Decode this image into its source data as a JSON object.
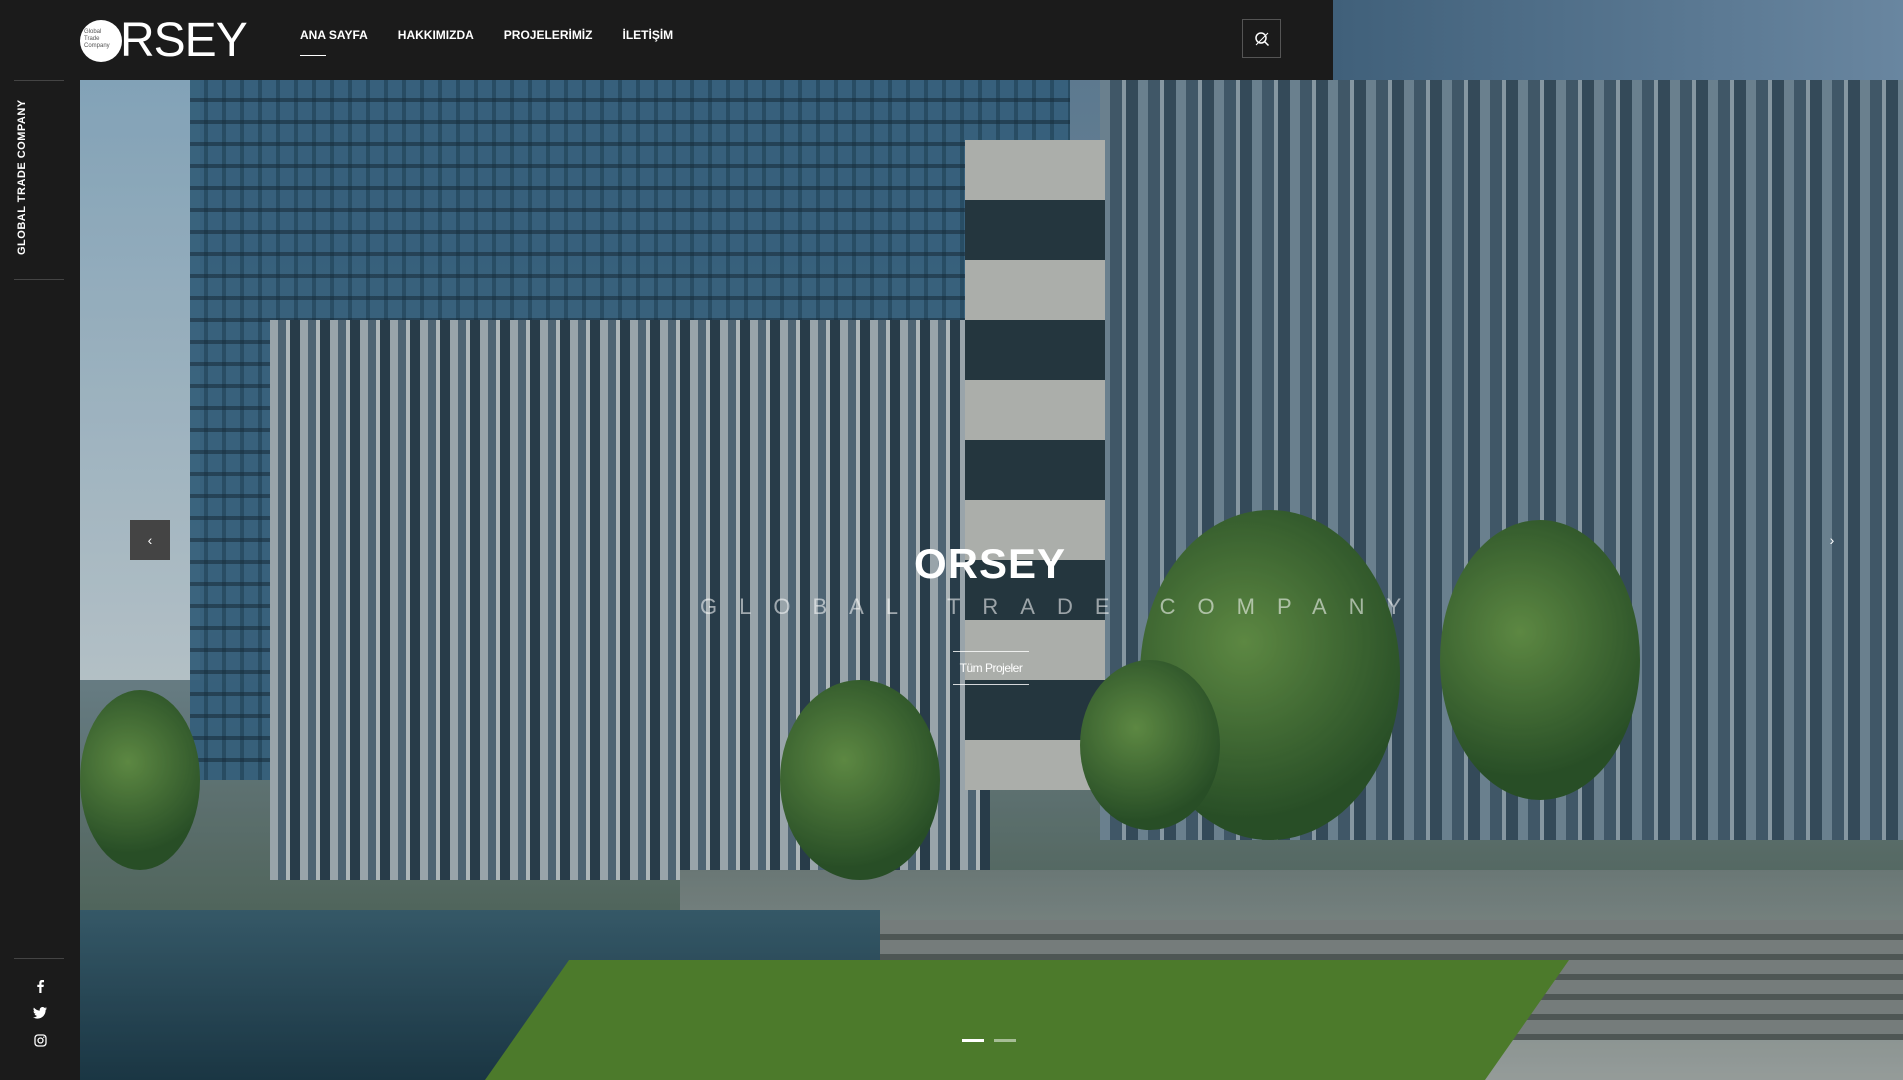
{
  "brand": {
    "logo_word": "RSEY",
    "logo_circle_text": "Global Trade Company"
  },
  "nav": [
    {
      "label": "ANA SAYFA",
      "active": true
    },
    {
      "label": "HAKKIMIZDA",
      "active": false
    },
    {
      "label": "PROJELERİMİZ",
      "active": false
    },
    {
      "label": "İLETİŞİM",
      "active": false
    }
  ],
  "sidebar": {
    "vertical_text": "GLOBAL TRADE COMPANY",
    "social": [
      "facebook-icon",
      "twitter-icon",
      "instagram-icon"
    ]
  },
  "hero": {
    "title": "ORSEY",
    "subtitle": "GLOBAL TRADE COMPANY",
    "button_label": "Tüm Projeler",
    "prev_icon": "‹",
    "next_icon": "›",
    "slides": 2,
    "active_slide": 0
  },
  "colors": {
    "background": "#1b1b1b",
    "text": "#ffffff"
  }
}
